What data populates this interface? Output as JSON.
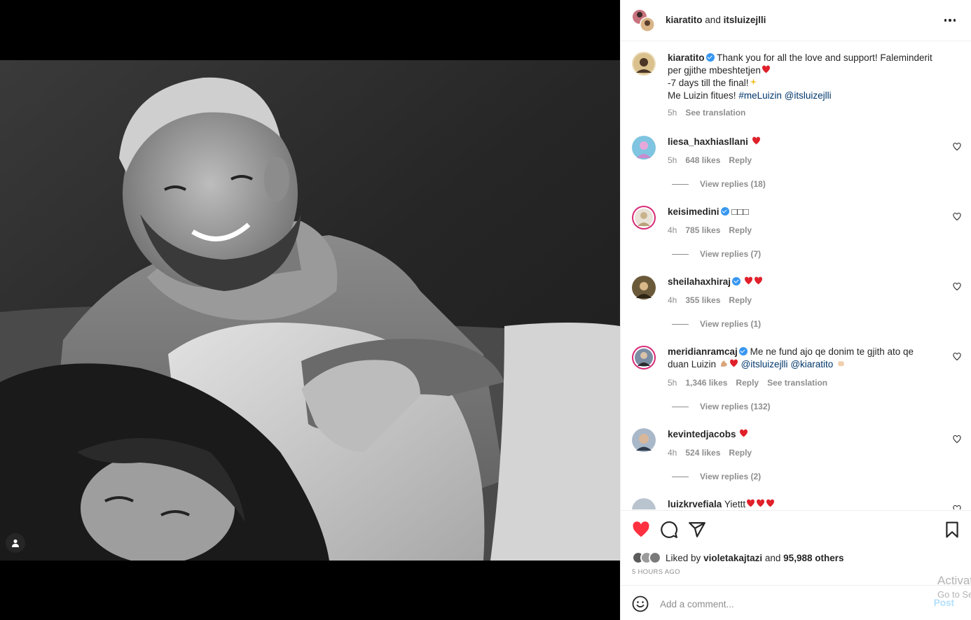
{
  "header": {
    "author": "kiaratito",
    "connector": "and",
    "coauthor": "itsluizejlli"
  },
  "caption": {
    "username": "kiaratito",
    "line1": "Thank you for all the love and support! Faleminderit per gjithe mbeshtetjen",
    "line2": "-7 days till the final!",
    "line3_prefix": "Me Luizin fitues!",
    "hashtag": "#meLuizin",
    "mention": "@itsluizejlli",
    "time": "5h",
    "translate": "See translation"
  },
  "comments": [
    {
      "username": "liesa_haxhiasllani",
      "text": "",
      "hearts": 1,
      "time": "5h",
      "likes": "648 likes",
      "reply": "Reply",
      "view_replies": "View replies (18)"
    },
    {
      "username": "keisimedini",
      "text": "□□□",
      "hearts": 0,
      "time": "4h",
      "likes": "785 likes",
      "reply": "Reply",
      "view_replies": "View replies (7)"
    },
    {
      "username": "sheilahaxhiraj",
      "text": "",
      "hearts": 2,
      "time": "4h",
      "likes": "355 likes",
      "reply": "Reply",
      "view_replies": "View replies (1)"
    },
    {
      "username": "meridianramcaj",
      "text": "Me ne fund ajo qe donim te gjith ato qe duan Luizin",
      "mention1": "@itsluizejlli",
      "mention2": "@kiaratito",
      "time": "5h",
      "likes": "1,346 likes",
      "reply": "Reply",
      "translate": "See translation",
      "view_replies": "View replies (132)"
    },
    {
      "username": "kevintedjacobs",
      "text": "",
      "hearts": 1,
      "time": "4h",
      "likes": "524 likes",
      "reply": "Reply",
      "view_replies": "View replies (2)"
    },
    {
      "username": "luizkrvefiala",
      "text": "Yiettt"
    }
  ],
  "likes": {
    "prefix": "Liked by",
    "user": "violetakajtazi",
    "middle": "and",
    "others": "95,988 others"
  },
  "timestamp": "5 HOURS AGO",
  "add_comment": {
    "placeholder": "Add a comment...",
    "post": "Post"
  },
  "watermark": {
    "line1": "Activate Windows",
    "line2": "Go to Settings to activate Windows."
  },
  "colors": {
    "heart": "#ed4956",
    "link": "#00376b",
    "verified": "#3897f0",
    "muted": "#8e8e8e"
  }
}
